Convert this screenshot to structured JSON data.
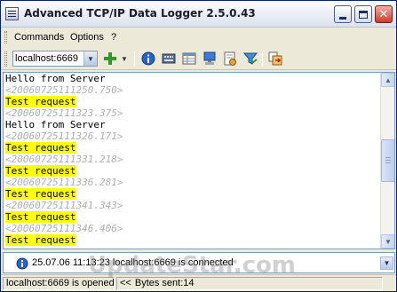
{
  "window": {
    "title": "Advanced TCP/IP Data Logger 2.5.0.43"
  },
  "menu": {
    "items": [
      {
        "label": "Commands"
      },
      {
        "label": "Options"
      },
      {
        "label": "?"
      }
    ]
  },
  "toolbar": {
    "host_value": "localhost:6669",
    "icons": [
      "add-connection-icon",
      "info-icon",
      "keyboard-icon",
      "data-table-icon",
      "computer-monitor-icon",
      "log-file-icon",
      "filter-icon",
      "copy-export-icon"
    ]
  },
  "log": {
    "lines": [
      {
        "kind": "server",
        "text": "Hello from Server"
      },
      {
        "kind": "ts",
        "text": "<20060725111250.750>"
      },
      {
        "kind": "req",
        "text": "Test request"
      },
      {
        "kind": "ts",
        "text": "<20060725111323.375>"
      },
      {
        "kind": "server",
        "text": "Hello from Server"
      },
      {
        "kind": "ts",
        "text": "<20060725111326.171>"
      },
      {
        "kind": "req",
        "text": "Test request"
      },
      {
        "kind": "ts",
        "text": "<20060725111331.218>"
      },
      {
        "kind": "req",
        "text": "Test request"
      },
      {
        "kind": "ts",
        "text": "<20060725111336.281>"
      },
      {
        "kind": "req",
        "text": "Test request"
      },
      {
        "kind": "ts",
        "text": "<20060725111341.343>"
      },
      {
        "kind": "req",
        "text": "Test request"
      },
      {
        "kind": "ts",
        "text": "<20060725111346.406>"
      },
      {
        "kind": "req",
        "text": "Test request"
      }
    ]
  },
  "messages": {
    "current": "25.07.06 11:13:23 localhost:6669 is connected"
  },
  "status": {
    "connection": "localhost:6669 is opened",
    "bytes_arrows": "<<",
    "bytes_sent": "Bytes sent:14"
  },
  "watermark": "UpdateStar.com",
  "colors": {
    "highlight": "#ffff00",
    "timestamp": "#b0b0b0",
    "accent": "#0a246a"
  }
}
